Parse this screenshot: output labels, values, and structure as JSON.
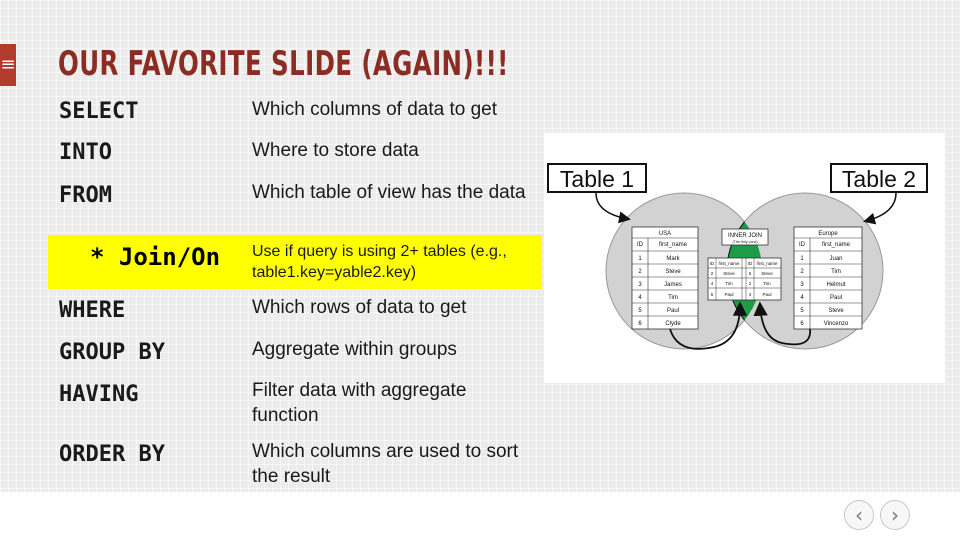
{
  "slide": {
    "menu_icon": "hamburger-icon",
    "title": "OUR FAVORITE SLIDE (AGAIN)!!!",
    "rows": [
      {
        "keyword": "SELECT",
        "description": "Which columns of data to get"
      },
      {
        "keyword": "INTO",
        "description": "Where to store data"
      },
      {
        "keyword": "FROM",
        "description": "Which table of view has the data"
      },
      {
        "keyword": "* Join/On",
        "description": "Use if query is using 2+ tables (e.g., table1.key=yable2.key)"
      },
      {
        "keyword": "WHERE",
        "description": "Which rows of data to get"
      },
      {
        "keyword": "GROUP BY",
        "description": "Aggregate within groups"
      },
      {
        "keyword": "HAVING",
        "description": "Filter data with aggregate function"
      },
      {
        "keyword": "ORDER BY",
        "description": "Which columns are used to sort the result"
      }
    ],
    "highlight_color": "#ffff00",
    "title_color": "#8b2d23"
  },
  "diagram": {
    "label_left": "Table 1",
    "label_right": "Table 2",
    "left_table": {
      "caption": "USA",
      "headers": [
        "ID",
        "first_name"
      ],
      "rows": [
        [
          "1",
          "Mark"
        ],
        [
          "2",
          "Steve"
        ],
        [
          "3",
          "James"
        ],
        [
          "4",
          "Tim"
        ],
        [
          "5",
          "Paul"
        ],
        [
          "6",
          "Clyde"
        ]
      ]
    },
    "right_table": {
      "caption": "Europe",
      "headers": [
        "ID",
        "first_name"
      ],
      "rows": [
        [
          "1",
          "Juan"
        ],
        [
          "2",
          "Tim"
        ],
        [
          "3",
          "Helmut"
        ],
        [
          "4",
          "Paul"
        ],
        [
          "5",
          "Steve"
        ],
        [
          "6",
          "Vincenzo"
        ]
      ]
    },
    "join": {
      "caption": "INNER JOIN",
      "subcaption": "(The Holy Land)",
      "headers": [
        "ID",
        "first_name",
        "ID",
        "first_name"
      ],
      "rows": [
        [
          "2",
          "Steve",
          "5",
          "Steve"
        ],
        [
          "4",
          "Tim",
          "2",
          "Tim"
        ],
        [
          "5",
          "Paul",
          "4",
          "Paul"
        ]
      ]
    },
    "join_color": "#1e9b48"
  },
  "nav": {
    "prev_icon": "chevron-left-icon",
    "next_icon": "chevron-right-icon",
    "prev_glyph": "‹",
    "next_glyph": "›"
  }
}
